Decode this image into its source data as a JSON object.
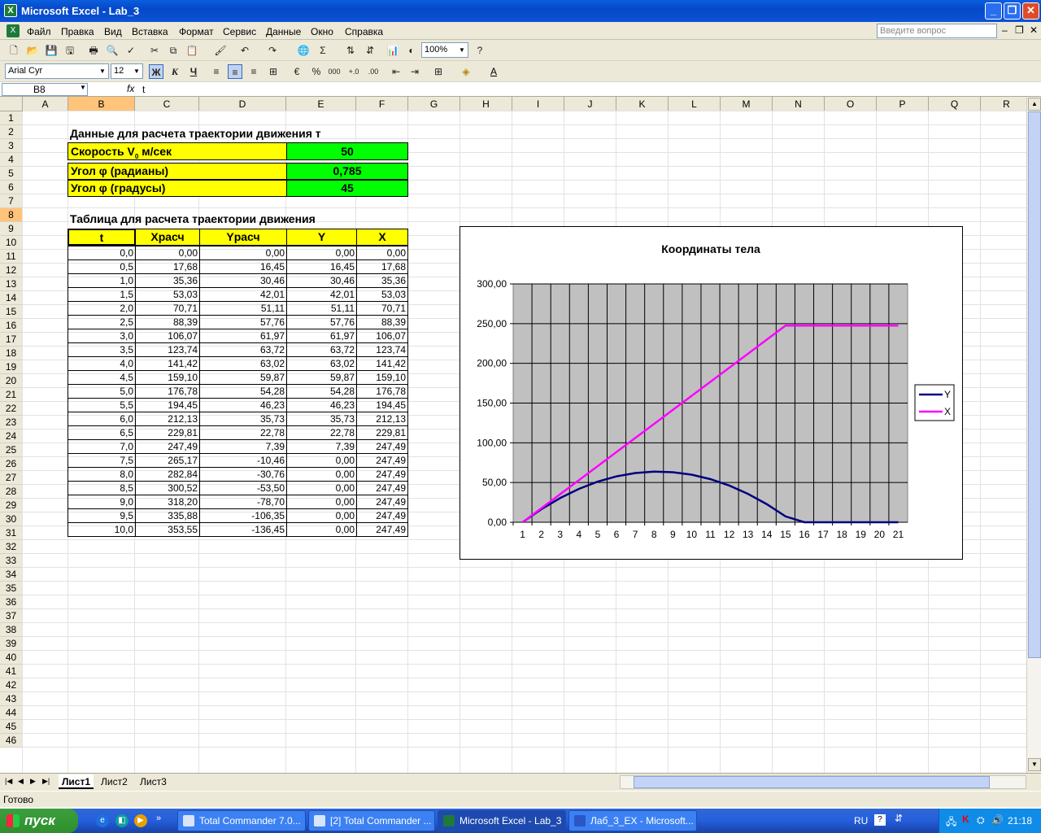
{
  "window": {
    "title": "Microsoft Excel - Lab_3"
  },
  "menu": {
    "items": [
      "Файл",
      "Правка",
      "Вид",
      "Вставка",
      "Формат",
      "Сервис",
      "Данные",
      "Окно",
      "Справка"
    ],
    "ask_placeholder": "Введите вопрос"
  },
  "toolbar": {
    "zoom": "100%"
  },
  "format_toolbar": {
    "font": "Arial Cyr",
    "size": "12",
    "bold": "Ж",
    "italic": "К",
    "underline": "Ч",
    "percent": "%",
    "thousands": "000"
  },
  "formula_bar": {
    "name_box": "B8",
    "fx": "fx",
    "value": "t"
  },
  "grid": {
    "columns": [
      "A",
      "B",
      "C",
      "D",
      "E",
      "F",
      "G",
      "H",
      "I",
      "J",
      "K",
      "L",
      "M",
      "N",
      "O",
      "P",
      "Q",
      "R"
    ],
    "rows": [
      "1",
      "2",
      "3",
      "4",
      "5",
      "6",
      "7",
      "8",
      "9",
      "10",
      "11",
      "12",
      "13",
      "14",
      "15",
      "16",
      "17",
      "18",
      "19",
      "20",
      "21",
      "22",
      "23",
      "24",
      "25",
      "26",
      "27",
      "28",
      "29",
      "30",
      "31",
      "32",
      "33",
      "34",
      "35",
      "36",
      "37",
      "38",
      "39",
      "40",
      "41",
      "42",
      "43",
      "44",
      "45",
      "46"
    ]
  },
  "sheet": {
    "heading1": "Данные для расчета траектории движения т",
    "speed_label": "Скорость V",
    "speed_sub": "0",
    "speed_unit": " м/сек",
    "speed_value": "50",
    "angle_rad_label": "Угол  φ (радианы)",
    "angle_rad_value": "0,785",
    "angle_deg_label": "Угол φ (градусы)",
    "angle_deg_value": "45",
    "heading2": "Таблица для расчета траектории движения",
    "table_headers": [
      "t",
      "Xрасч",
      "Yрасч",
      "Y",
      "X"
    ],
    "table_rows": [
      [
        "0,0",
        "0,00",
        "0,00",
        "0,00",
        "0,00"
      ],
      [
        "0,5",
        "17,68",
        "16,45",
        "16,45",
        "17,68"
      ],
      [
        "1,0",
        "35,36",
        "30,46",
        "30,46",
        "35,36"
      ],
      [
        "1,5",
        "53,03",
        "42,01",
        "42,01",
        "53,03"
      ],
      [
        "2,0",
        "70,71",
        "51,11",
        "51,11",
        "70,71"
      ],
      [
        "2,5",
        "88,39",
        "57,76",
        "57,76",
        "88,39"
      ],
      [
        "3,0",
        "106,07",
        "61,97",
        "61,97",
        "106,07"
      ],
      [
        "3,5",
        "123,74",
        "63,72",
        "63,72",
        "123,74"
      ],
      [
        "4,0",
        "141,42",
        "63,02",
        "63,02",
        "141,42"
      ],
      [
        "4,5",
        "159,10",
        "59,87",
        "59,87",
        "159,10"
      ],
      [
        "5,0",
        "176,78",
        "54,28",
        "54,28",
        "176,78"
      ],
      [
        "5,5",
        "194,45",
        "46,23",
        "46,23",
        "194,45"
      ],
      [
        "6,0",
        "212,13",
        "35,73",
        "35,73",
        "212,13"
      ],
      [
        "6,5",
        "229,81",
        "22,78",
        "22,78",
        "229,81"
      ],
      [
        "7,0",
        "247,49",
        "7,39",
        "7,39",
        "247,49"
      ],
      [
        "7,5",
        "265,17",
        "-10,46",
        "0,00",
        "247,49"
      ],
      [
        "8,0",
        "282,84",
        "-30,76",
        "0,00",
        "247,49"
      ],
      [
        "8,5",
        "300,52",
        "-53,50",
        "0,00",
        "247,49"
      ],
      [
        "9,0",
        "318,20",
        "-78,70",
        "0,00",
        "247,49"
      ],
      [
        "9,5",
        "335,88",
        "-106,35",
        "0,00",
        "247,49"
      ],
      [
        "10,0",
        "353,55",
        "-136,45",
        "0,00",
        "247,49"
      ]
    ]
  },
  "chart_data": {
    "type": "line",
    "title": "Координаты тела",
    "categories": [
      "1",
      "2",
      "3",
      "4",
      "5",
      "6",
      "7",
      "8",
      "9",
      "10",
      "11",
      "12",
      "13",
      "14",
      "15",
      "16",
      "17",
      "18",
      "19",
      "20",
      "21"
    ],
    "y_ticks": [
      "0,00",
      "50,00",
      "100,00",
      "150,00",
      "200,00",
      "250,00",
      "300,00"
    ],
    "ylim": [
      0,
      300
    ],
    "grid": true,
    "legend": "right",
    "series": [
      {
        "name": "Y",
        "color": "#000080",
        "values": [
          0,
          16.45,
          30.46,
          42.01,
          51.11,
          57.76,
          61.97,
          63.72,
          63.02,
          59.87,
          54.28,
          46.23,
          35.73,
          22.78,
          7.39,
          0,
          0,
          0,
          0,
          0,
          0
        ]
      },
      {
        "name": "X",
        "color": "#ff00ff",
        "values": [
          0,
          17.68,
          35.36,
          53.03,
          70.71,
          88.39,
          106.07,
          123.74,
          141.42,
          159.1,
          176.78,
          194.45,
          212.13,
          229.81,
          247.49,
          247.49,
          247.49,
          247.49,
          247.49,
          247.49,
          247.49
        ]
      }
    ]
  },
  "sheets": {
    "tabs": [
      "Лист1",
      "Лист2",
      "Лист3"
    ]
  },
  "status": {
    "text": "Готово"
  },
  "taskbar": {
    "start": "пуск",
    "tasks": [
      "Total Commander 7.0...",
      "[2] Total Commander ...",
      "Microsoft Excel - Lab_3",
      "Лаб_3_EX - Microsoft..."
    ],
    "lang": "RU",
    "clock": "21:18"
  }
}
